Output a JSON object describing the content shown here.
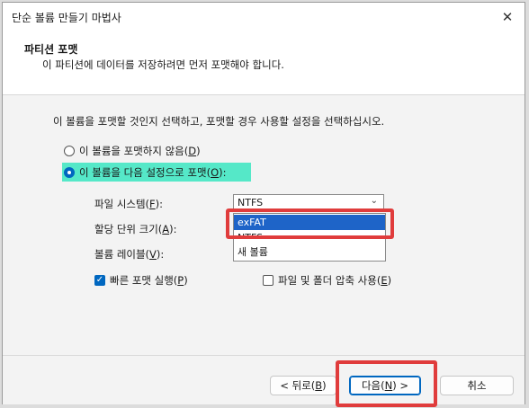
{
  "window": {
    "title": "단순 볼륨 만들기 마법사",
    "close_glyph": "✕"
  },
  "header": {
    "title": "파티션 포맷",
    "subtitle": "이 파티션에 데이터를 저장하려면 먼저 포맷해야 합니다."
  },
  "body": {
    "instruction": "이 볼륨을 포맷할 것인지 선택하고, 포맷할 경우 사용할 설정을 선택하십시오.",
    "radio_no_format": {
      "text": "이 볼륨을 포맷하지 않음(",
      "key": "D",
      "end": ")",
      "checked": false
    },
    "radio_format": {
      "text": "이 볼륨을 다음 설정으로 포맷(",
      "key": "O",
      "end": "):",
      "checked": true
    },
    "highlight_color": "#55e8c8"
  },
  "fields": {
    "filesystem": {
      "text": "파일 시스템(",
      "key": "F",
      "end": "):"
    },
    "allocation": {
      "text": "할당 단위 크기(",
      "key": "A",
      "end": "):"
    },
    "label": {
      "text": "볼륨 레이블(",
      "key": "V",
      "end": "):"
    }
  },
  "filesystem_combo": {
    "value": "NTFS",
    "chevron": "⌄",
    "options": [
      "exFAT",
      "NTFS",
      "새 볼륨"
    ],
    "selected_option": "exFAT"
  },
  "checkboxes": {
    "quick_format": {
      "text": "빠른 포맷 실행(",
      "key": "P",
      "end": ")",
      "checked": true
    },
    "compression": {
      "text": "파일 및 폴더 압축 사용(",
      "key": "E",
      "end": ")",
      "checked": false
    }
  },
  "buttons": {
    "back": {
      "text": "< 뒤로(",
      "key": "B",
      "end": ")"
    },
    "next": {
      "text": "다음(",
      "key": "N",
      "end": ") >"
    },
    "cancel": "취소"
  },
  "annotation": {
    "color": "#e03c3c"
  }
}
